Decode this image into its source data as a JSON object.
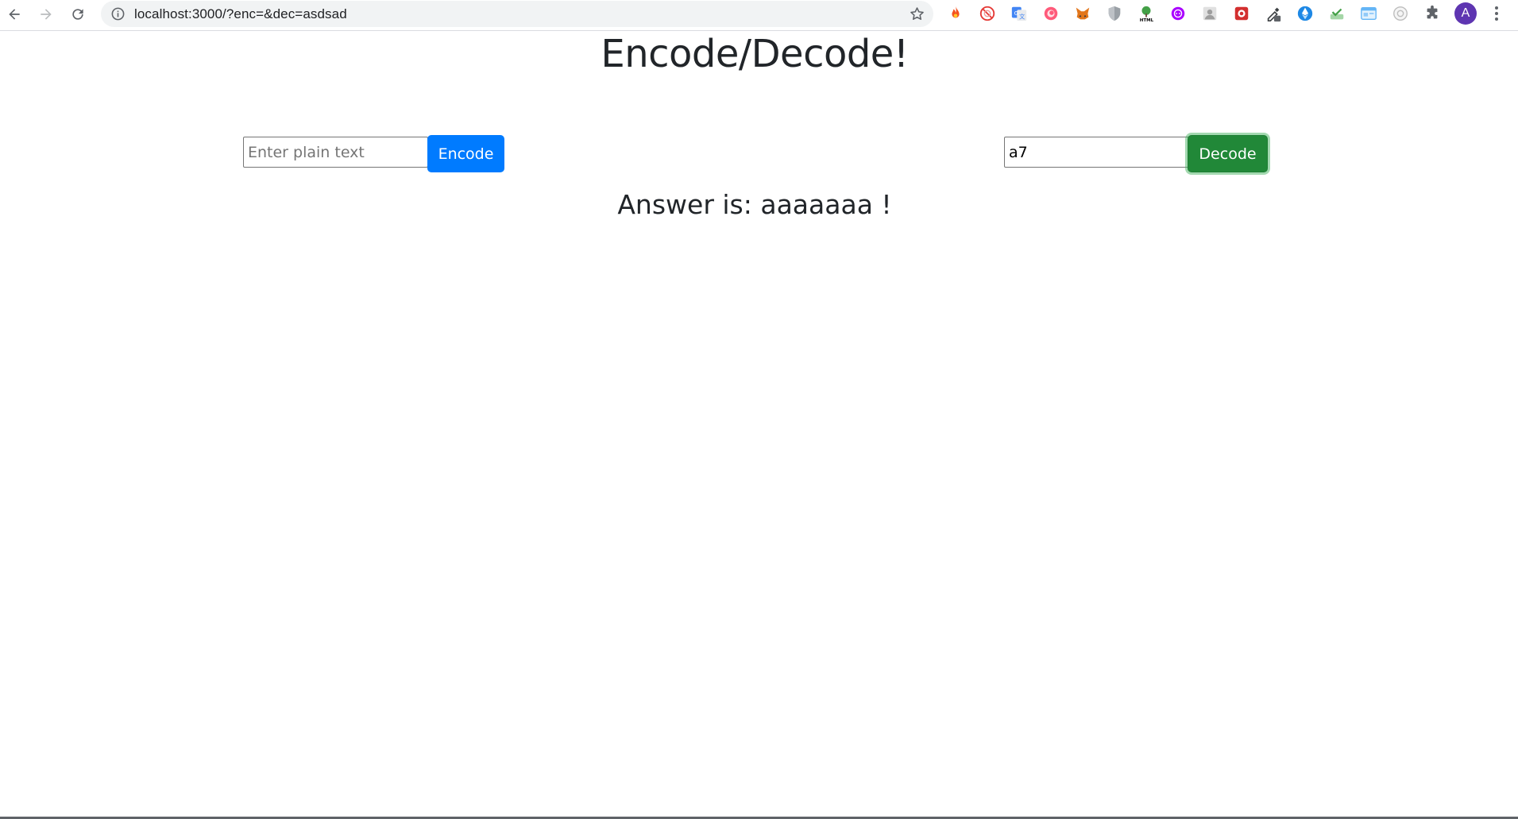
{
  "browser": {
    "url": "localhost:3000/?enc=&dec=asdsad",
    "avatar_letter": "A",
    "extensions": [
      "fire-extension-icon",
      "no-entry-extension-icon",
      "google-translate-extension-icon",
      "pink-circle-extension-icon",
      "metamask-fox-extension-icon",
      "shield-extension-icon",
      "html-tree-extension-icon",
      "purple-circle-extension-icon",
      "photo-extension-icon",
      "red-box-extension-icon",
      "eyedropper-extension-icon",
      "ethereum-extension-icon",
      "checkmark-tray-extension-icon",
      "window-card-extension-icon",
      "circle-extension-icon",
      "puzzle-extension-icon"
    ]
  },
  "page": {
    "title": "Encode/Decode!",
    "encode": {
      "placeholder": "Enter plain text",
      "value": "",
      "button_label": "Encode"
    },
    "decode": {
      "placeholder": "",
      "value": "a7",
      "button_label": "Decode"
    },
    "answer": "Answer is: aaaaaaa !"
  },
  "colors": {
    "encode_button": "#007bff",
    "decode_button": "#218838",
    "text": "#212529"
  }
}
